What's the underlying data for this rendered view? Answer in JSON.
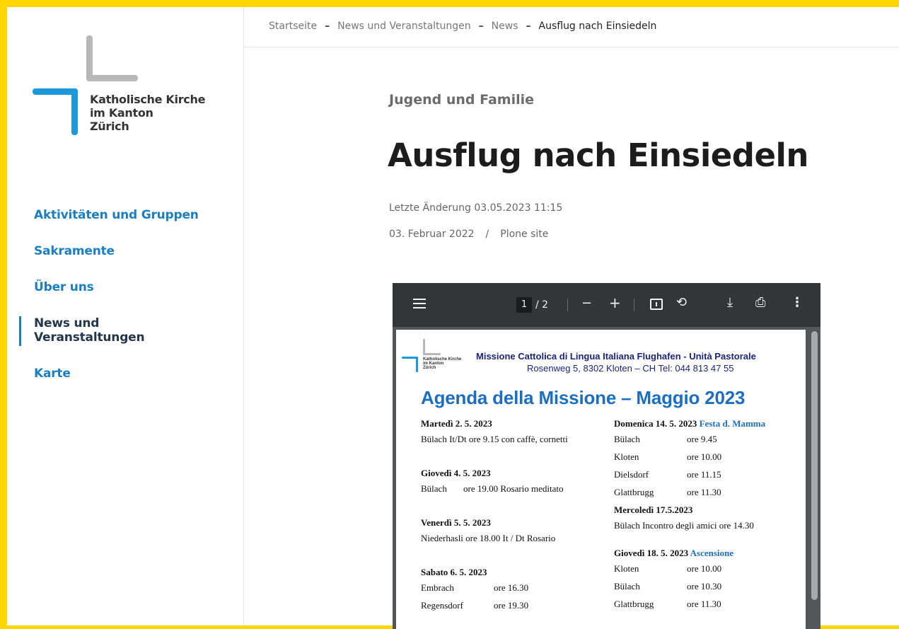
{
  "brand": {
    "logo_lines": [
      "Katholische Kirche",
      "im Kanton",
      "Zürich"
    ],
    "accent_color": "#ffd600",
    "link_color": "#1a7fc1",
    "logo_blue": "#1e98dc"
  },
  "sidebar": {
    "items": [
      {
        "label": "Aktivitäten und Gruppen"
      },
      {
        "label": "Sakramente"
      },
      {
        "label": "Über uns"
      },
      {
        "label_lines": [
          "News und",
          "Veranstaltungen"
        ],
        "active": true
      },
      {
        "label": "Karte"
      }
    ]
  },
  "breadcrumb": {
    "items": [
      "Startseite",
      "News und Veranstaltungen",
      "News"
    ],
    "current": "Ausflug nach Einsiedeln",
    "separator": "–"
  },
  "article": {
    "category": "Jugend und Familie",
    "title": "Ausflug nach Einsiedeln",
    "modified": "Letzte Änderung 03.05.2023 11:15",
    "date": "03. Februar 2022",
    "byline_sep": "/",
    "author": "Plone site"
  },
  "pdf_viewer": {
    "current_page": "1",
    "total_pages": "/ 2",
    "icons": [
      "menu-icon",
      "zoom-out-icon",
      "zoom-in-icon",
      "fit-page-icon",
      "rotate-icon",
      "download-icon",
      "print-icon",
      "more-options-icon"
    ],
    "zoom_out_symbol": "−",
    "zoom_in_symbol": "+",
    "rotate_symbol": "⟲",
    "download_symbol": "⤓",
    "print_symbol": "⎙",
    "more_symbol": "⋮"
  },
  "document": {
    "logo_lines": [
      "Katholische Kirche",
      "im Kanton",
      "Zürich"
    ],
    "org": "Missione Cattolica di Lingua Italiana Flughafen - Unità Pastorale",
    "address": "Rosenweg 5, 8302 Kloten – CH   Tel:  044 813 47 55",
    "title": "Agenda della Missione – Maggio 2023",
    "left": {
      "e1": {
        "head": "Martedì 2. 5. 2023",
        "line": "Bülach It/Dt ore 9.15 con caffè, cornetti"
      },
      "e2": {
        "head": "Giovedì 4. 5. 2023",
        "place": "Bülach",
        "line": "ore 19.00 Rosario meditato"
      },
      "e3": {
        "head": "Venerdì 5. 5. 2023",
        "line": "Niederhasli ore 18.00 It / Dt  Rosario"
      },
      "e4": {
        "head": "Sabato 6. 5. 2023",
        "rows": [
          {
            "place": "Embrach",
            "time": "ore 16.30"
          },
          {
            "place": "Regensdorf",
            "time": "ore 19.30"
          }
        ]
      }
    },
    "right": {
      "e1": {
        "head": "Domenica 14. 5. 2023",
        "accent": "Festa d. Mamma",
        "rows": [
          {
            "place": "Bülach",
            "time": "ore  9.45"
          },
          {
            "place": "Kloten",
            "time": "ore 10.00"
          },
          {
            "place": "Dielsdorf",
            "time": "ore 11.15"
          },
          {
            "place": "Glattbrugg",
            "time": "ore 11.30"
          }
        ]
      },
      "e2": {
        "head": "Mercoledì 17.5.2023",
        "line": "Bülach  Incontro degli amici ore 14.30"
      },
      "e3": {
        "head": "Giovedì 18. 5. 2023",
        "accent": "Ascensione",
        "rows": [
          {
            "place": "Kloten",
            "time": "ore 10.00"
          },
          {
            "place": "Bülach",
            "time": "ore 10.30"
          },
          {
            "place": "Glattbrugg",
            "time": "ore 11.30"
          }
        ]
      }
    }
  }
}
